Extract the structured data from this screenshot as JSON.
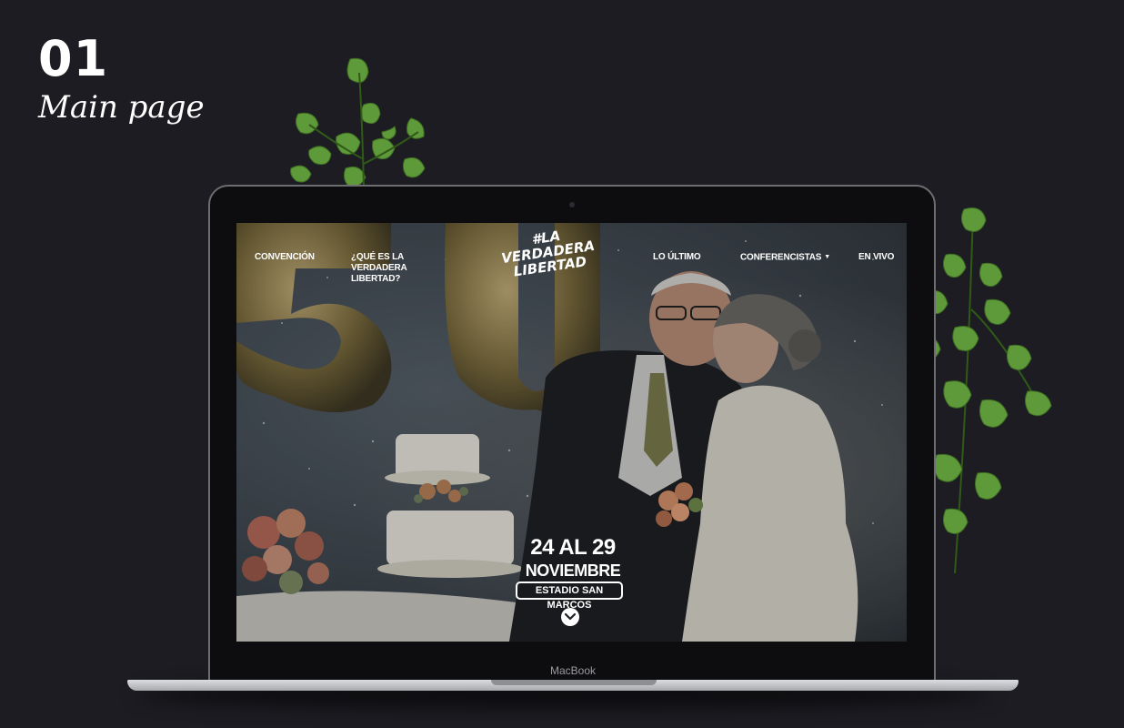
{
  "heading": {
    "number": "01",
    "subtitle": "Main page"
  },
  "laptop": {
    "brand": "MacBook"
  },
  "site": {
    "nav": {
      "convencion": "CONVENCIÓN",
      "que_es": "¿QUÉ ES LA VERDADERA LIBERTAD?",
      "lo_ultimo": "LO ÚLTIMO",
      "conferencistas": "CONFERENCISTAS",
      "en_vivo": "EN VIVO"
    },
    "logo": "#LA VERDADERA LIBERTAD",
    "event": {
      "dates": "24 AL 29",
      "month": "NOVIEMBRE",
      "venue": "ESTADIO SAN MARCOS"
    }
  },
  "icons": {
    "caret": "caret-down-icon",
    "scroll": "chevron-down-icon"
  },
  "colors": {
    "page_background": "#1c1c22",
    "text": "#ffffff",
    "leaf_green": "#5f9a3a"
  }
}
